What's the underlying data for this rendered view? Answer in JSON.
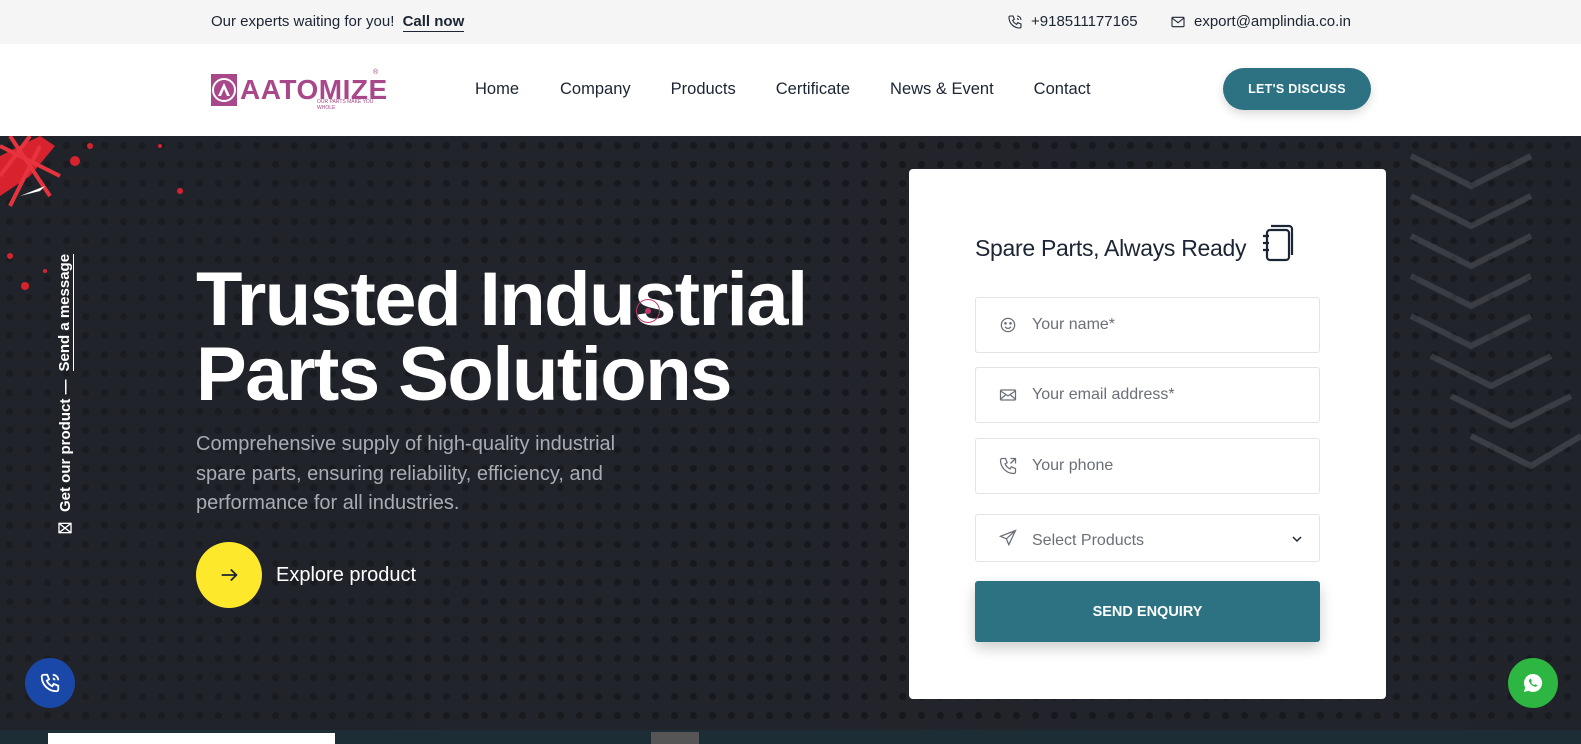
{
  "topbar": {
    "tagline": "Our experts waiting for you!",
    "call_link": "Call now",
    "phone": "+918511177165",
    "email": "export@amplindia.co.in"
  },
  "header": {
    "logo_text": "AATOMIZE",
    "logo_tag": "OUR PARTS MAKE YOU WHOLE",
    "nav": [
      "Home",
      "Company",
      "Products",
      "Certificate",
      "News & Event",
      "Contact"
    ],
    "cta_label": "LET'S DISCUSS"
  },
  "hero": {
    "side_link": "Send a message",
    "side_text": "Get our product —",
    "headline_line1": "Trusted Industrial",
    "headline_line2": "Parts Solutions",
    "subtext": "Comprehensive supply of high-quality industrial spare parts, ensuring reliability, efficiency, and performance for all industries.",
    "explore_label": "Explore product",
    "accent_yellow": "#fee82b"
  },
  "form": {
    "title": "Spare Parts, Always Ready",
    "name_placeholder": "Your name*",
    "email_placeholder": "Your email address*",
    "phone_placeholder": "Your phone",
    "select_placeholder": "Select Products",
    "submit_label": "SEND ENQUIRY",
    "brand_color": "#2c7282"
  },
  "floating": {
    "call_icon": "phone-icon",
    "whatsapp_icon": "whatsapp-icon"
  }
}
